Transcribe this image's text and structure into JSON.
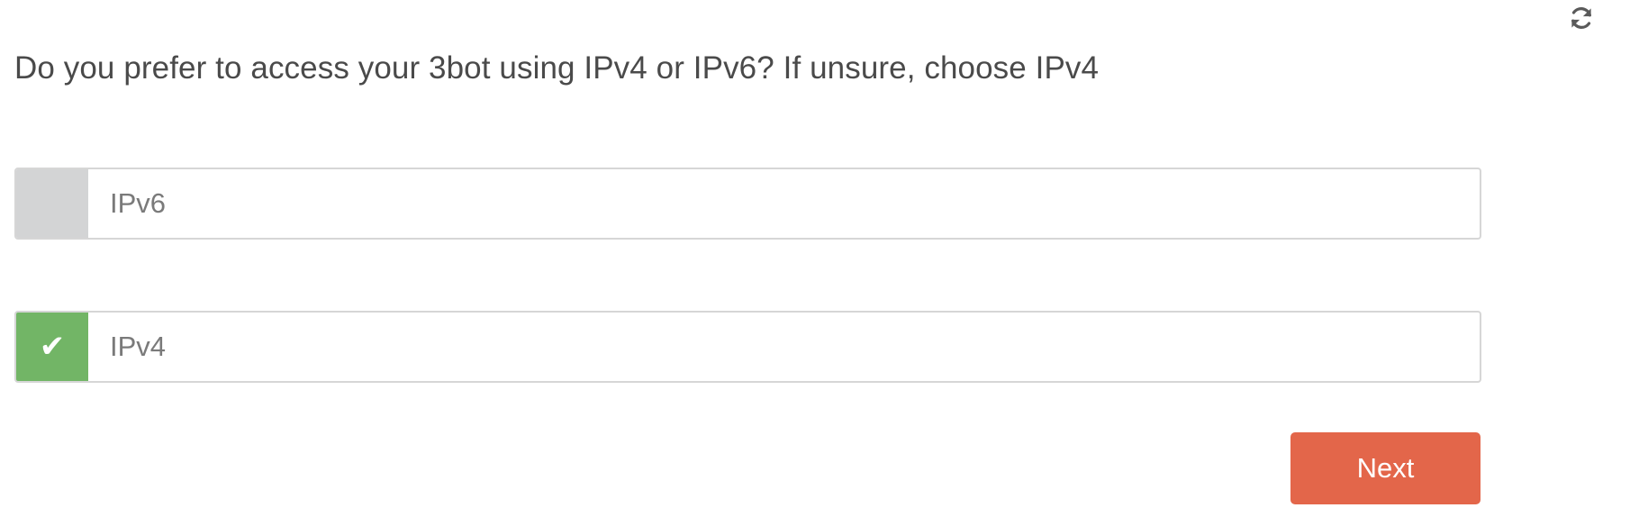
{
  "header": {
    "refresh_icon": "refresh-icon"
  },
  "question": {
    "text": "Do you prefer to access your 3bot using IPv4 or IPv6? If unsure, choose IPv4"
  },
  "options": [
    {
      "label": "IPv6",
      "selected": false,
      "check": ""
    },
    {
      "label": "IPv4",
      "selected": true,
      "check": "✔"
    }
  ],
  "colors": {
    "selected_check_bg": "#72b566",
    "unselected_check_bg": "#d3d4d5",
    "next_button_bg": "#e3664a",
    "text": "#4a4a4a"
  },
  "actions": {
    "next_label": "Next"
  }
}
